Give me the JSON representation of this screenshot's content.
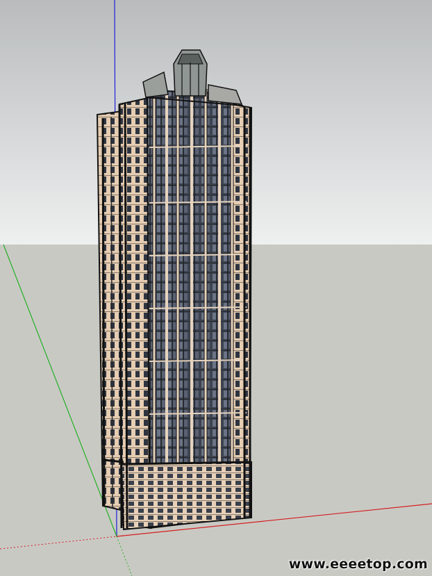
{
  "watermark": {
    "text": "www.eeeetop.com"
  },
  "colors": {
    "sky_top": "#b9bcbd",
    "sky_bottom": "#eef0f0",
    "ground": "#c9c9c4",
    "axis_blue": "#1f1fd8",
    "axis_green": "#23b023",
    "axis_red": "#d21e1e",
    "facade_beige": "#e6cdb2",
    "glass_dark": "#4e5563",
    "frame_dark": "#1a1a1a"
  },
  "icons": {
    "building": "skyscraper-model"
  }
}
